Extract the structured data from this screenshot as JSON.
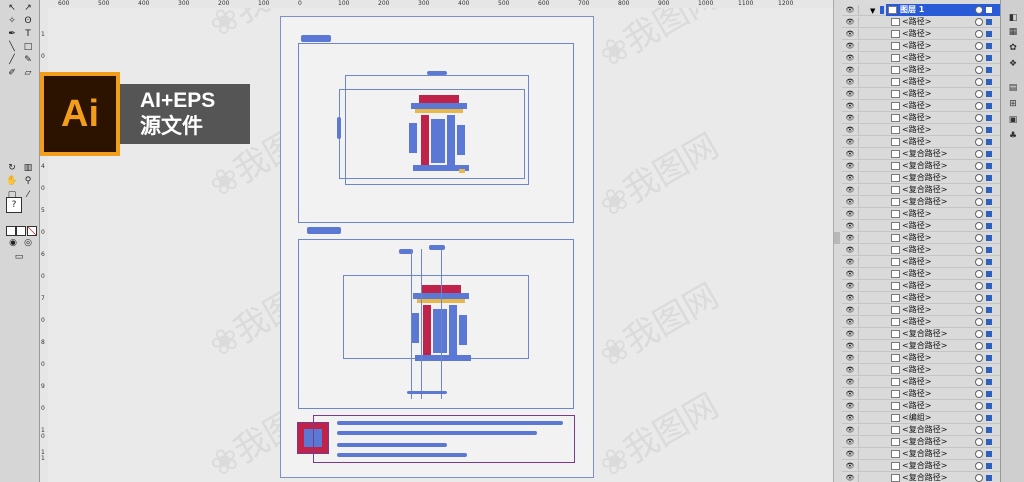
{
  "ruler": {
    "h_ticks": [
      "600",
      "500",
      "400",
      "300",
      "200",
      "100",
      "0",
      "100",
      "200",
      "300",
      "400",
      "500",
      "600",
      "700",
      "800",
      "900",
      "1000",
      "1100",
      "1200"
    ],
    "v_ticks": [
      "1",
      "0",
      "2",
      "0",
      "3",
      "0",
      "4",
      "0",
      "5",
      "0",
      "6",
      "0",
      "7",
      "0",
      "8",
      "0",
      "9",
      "0",
      "1 0",
      "1 1"
    ]
  },
  "badge": {
    "logo_text": "Ai",
    "line1": "AI+EPS",
    "line2": "源文件"
  },
  "layers": {
    "top": {
      "name": "图层 1",
      "color": "#2a5bd6"
    },
    "rows": [
      "<路径>",
      "<路径>",
      "<路径>",
      "<路径>",
      "<路径>",
      "<路径>",
      "<路径>",
      "<路径>",
      "<路径>",
      "<路径>",
      "<路径>",
      "<复合路径>",
      "<复合路径>",
      "<复合路径>",
      "<复合路径>",
      "<复合路径>",
      "<路径>",
      "<路径>",
      "<路径>",
      "<路径>",
      "<路径>",
      "<路径>",
      "<路径>",
      "<路径>",
      "<路径>",
      "<路径>",
      "<复合路径>",
      "<复合路径>",
      "<路径>",
      "<路径>",
      "<路径>",
      "<路径>",
      "<路径>",
      "<编组>",
      "<复合路径>",
      "<复合路径>",
      "<复合路径>",
      "<复合路径>",
      "<复合路径>",
      "<复合路径>"
    ]
  },
  "colors": {
    "accent": "#2a5bd6",
    "artwork_blue": "#5b79d4",
    "artwork_red": "#c0234a",
    "logo_orange": "#f29e1b"
  }
}
